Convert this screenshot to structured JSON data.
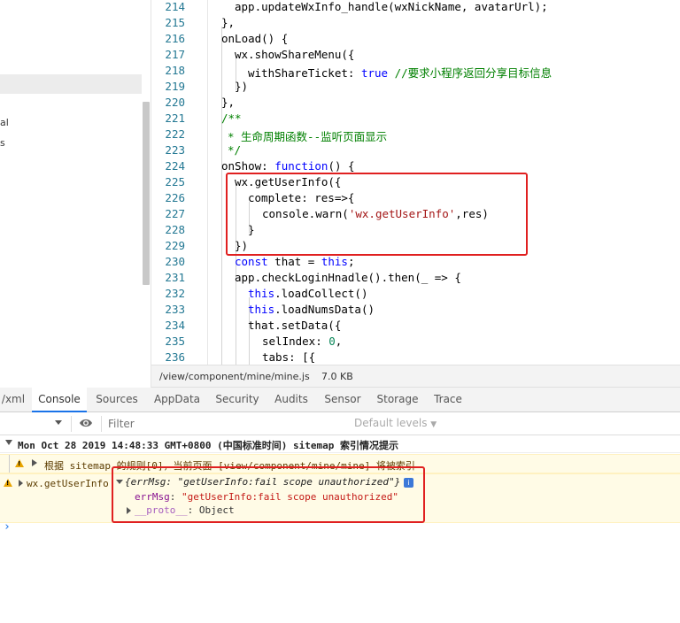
{
  "left_panel": {
    "fragment_1": "al",
    "fragment_2": "s"
  },
  "editor": {
    "lines": [
      {
        "n": "214",
        "code": "app.updateWxInfo_handle(wxNickName, avatarUrl);"
      },
      {
        "n": "215",
        "code": "},"
      },
      {
        "n": "216",
        "code": "onLoad() {"
      },
      {
        "n": "217",
        "code": "wx.showShareMenu({"
      },
      {
        "n": "218",
        "key": "withShareTicket: ",
        "val": "true",
        "comment": "//要求小程序返回分享目标信息"
      },
      {
        "n": "219",
        "code": "})"
      },
      {
        "n": "220",
        "code": "},"
      },
      {
        "n": "221",
        "code": "/**"
      },
      {
        "n": "222",
        "code": "* 生命周期函数--监听页面显示"
      },
      {
        "n": "223",
        "code": "*/"
      },
      {
        "n": "224",
        "pre": "onShow: ",
        "kw": "function",
        "post": "() {"
      },
      {
        "n": "225",
        "code": "wx.getUserInfo({"
      },
      {
        "n": "226",
        "code": "complete: res=>{"
      },
      {
        "n": "227",
        "pre": "console.warn(",
        "str": "'wx.getUserInfo'",
        "post": ",res)"
      },
      {
        "n": "228",
        "code": "}"
      },
      {
        "n": "229",
        "code": "})"
      },
      {
        "n": "230",
        "kw": "const",
        "mid": " that = ",
        "kw2": "this",
        "post": ";"
      },
      {
        "n": "231",
        "code": "app.checkLoginHnadle().then(_ => {"
      },
      {
        "n": "232",
        "kw": "this",
        "post": ".loadCollect()"
      },
      {
        "n": "233",
        "kw": "this",
        "post": ".loadNumsData()"
      },
      {
        "n": "234",
        "code": "that.setData({"
      },
      {
        "n": "235",
        "pre": "selIndex: ",
        "num": "0",
        "post": ","
      },
      {
        "n": "236",
        "code": "tabs: [{"
      }
    ]
  },
  "file_bar": {
    "path": "/view/component/mine/mine.js",
    "size": "7.0 KB"
  },
  "tabs": [
    "/xml",
    "Console",
    "Sources",
    "AppData",
    "Security",
    "Audits",
    "Sensor",
    "Storage",
    "Trace"
  ],
  "toolbar": {
    "filter_placeholder": "Filter",
    "levels": "Default levels"
  },
  "console": {
    "group_header": "Mon Oct 28 2019 14:48:33 GMT+0800 (中国标准时间) sitemap 索引情况提示",
    "sitemap_warn": "根据 sitemap 的规则[0]，当前页面 [view/component/mine/mine] 将被索引",
    "warn_source": "wx.getUserInfo",
    "obj_summary": "{errMsg: \"getUserInfo:fail scope unauthorized\"}",
    "info_badge": "i",
    "prop_key": "errMsg",
    "prop_value": "\"getUserInfo:fail scope unauthorized\"",
    "proto_key": "__proto__",
    "proto_value": "Object"
  },
  "colors": {
    "highlight_box": "#e02020",
    "tab_active": "#1a73e8",
    "warn_bg": "#fffbe6"
  }
}
